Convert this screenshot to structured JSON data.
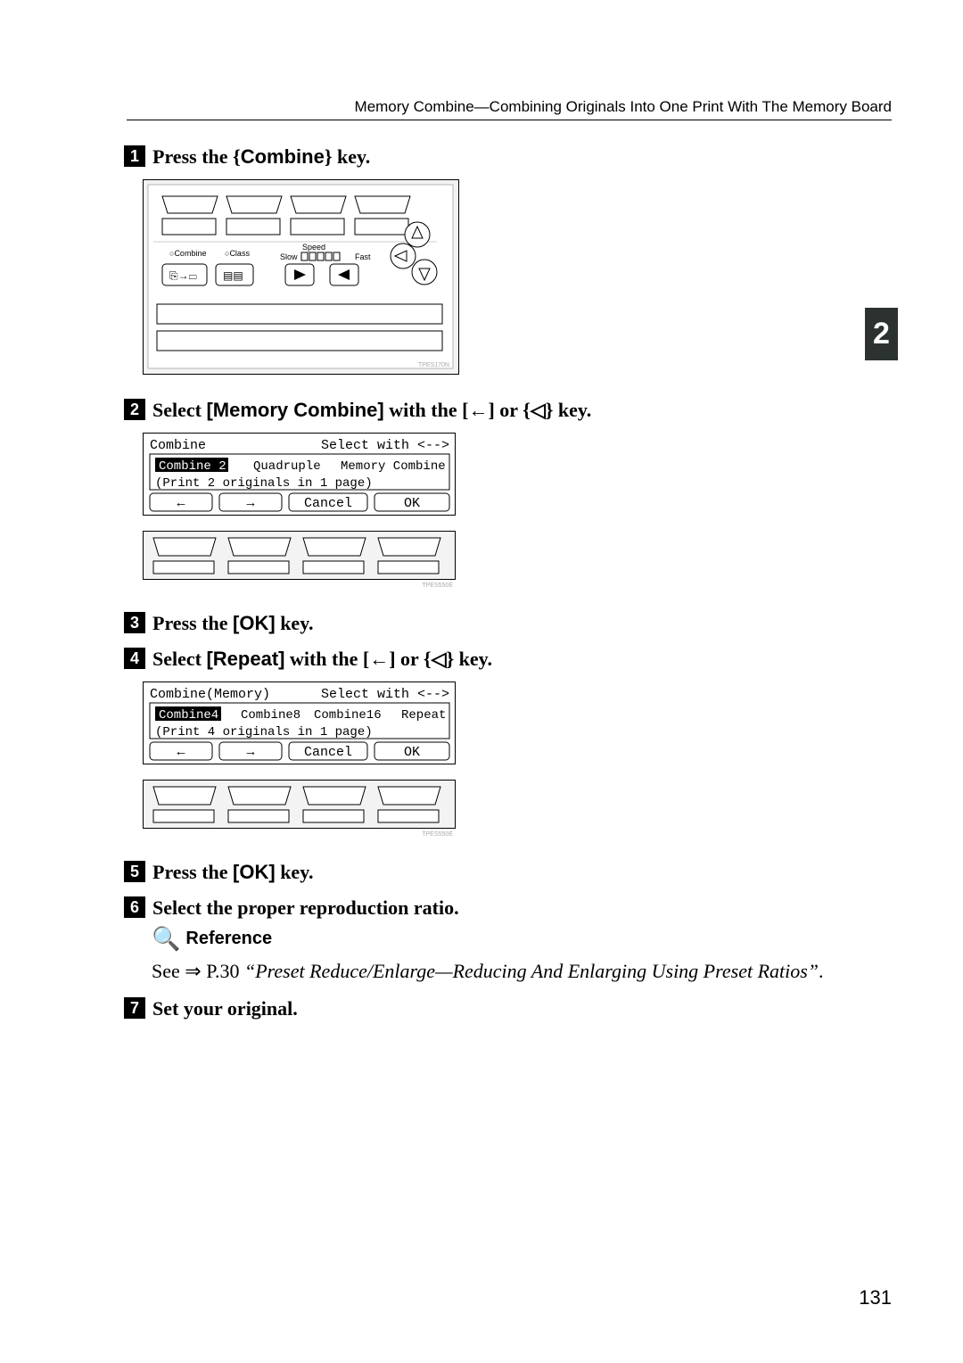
{
  "header": "Memory Combine—Combining Originals Into One Print With The Memory Board",
  "tab": "2",
  "steps": {
    "1": {
      "a": "Press the ",
      "b": "Combine",
      "c": " key."
    },
    "2": {
      "a": "Select ",
      "b": "[Memory Combine]",
      "c": " with the [",
      "d": "←",
      "e": "] or ",
      "f": "◁",
      "g": " key."
    },
    "3": {
      "a": "Press the ",
      "b": "[OK]",
      "c": " key."
    },
    "4": {
      "a": "Select ",
      "b": "[Repeat]",
      "c": " with the [",
      "d": "←",
      "e": "] or ",
      "f": "◁",
      "g": " key."
    },
    "5": {
      "a": "Press the ",
      "b": "[OK]",
      "c": " key."
    },
    "6": "Select the proper reproduction ratio.",
    "7": "Set your original."
  },
  "reference": {
    "label": "Reference",
    "text": "See ⇒ P.30 ",
    "ital": "“Preset Reduce/Enlarge—Reducing And Enlarging Using Preset Ratios”",
    "end": "."
  },
  "panel1": {
    "combine": "Combine",
    "class": "Class",
    "speed": "Speed",
    "slow": "Slow",
    "fast": "Fast",
    "tpes": "TPES170N"
  },
  "lcd1": {
    "title": "Combine",
    "hint": "Select with <-->",
    "opt1": "Combine 2",
    "opt2": "Quadruple",
    "opt3": "Memory Combine",
    "desc": "(Print 2 originals in 1 page)",
    "left": "←",
    "right": "→",
    "cancel": "Cancel",
    "ok": "OK",
    "tpes": "TPES550E"
  },
  "lcd2": {
    "title": "Combine(Memory)",
    "hint": "Select with <-->",
    "opt1": "Combine4",
    "opt2": "Combine8",
    "opt3": "Combine16",
    "opt4": "Repeat",
    "desc": "(Print 4 originals in 1 page)",
    "left": "←",
    "right": "→",
    "cancel": "Cancel",
    "ok": "OK",
    "tpes": "TPES550E"
  },
  "pagenum": "131"
}
